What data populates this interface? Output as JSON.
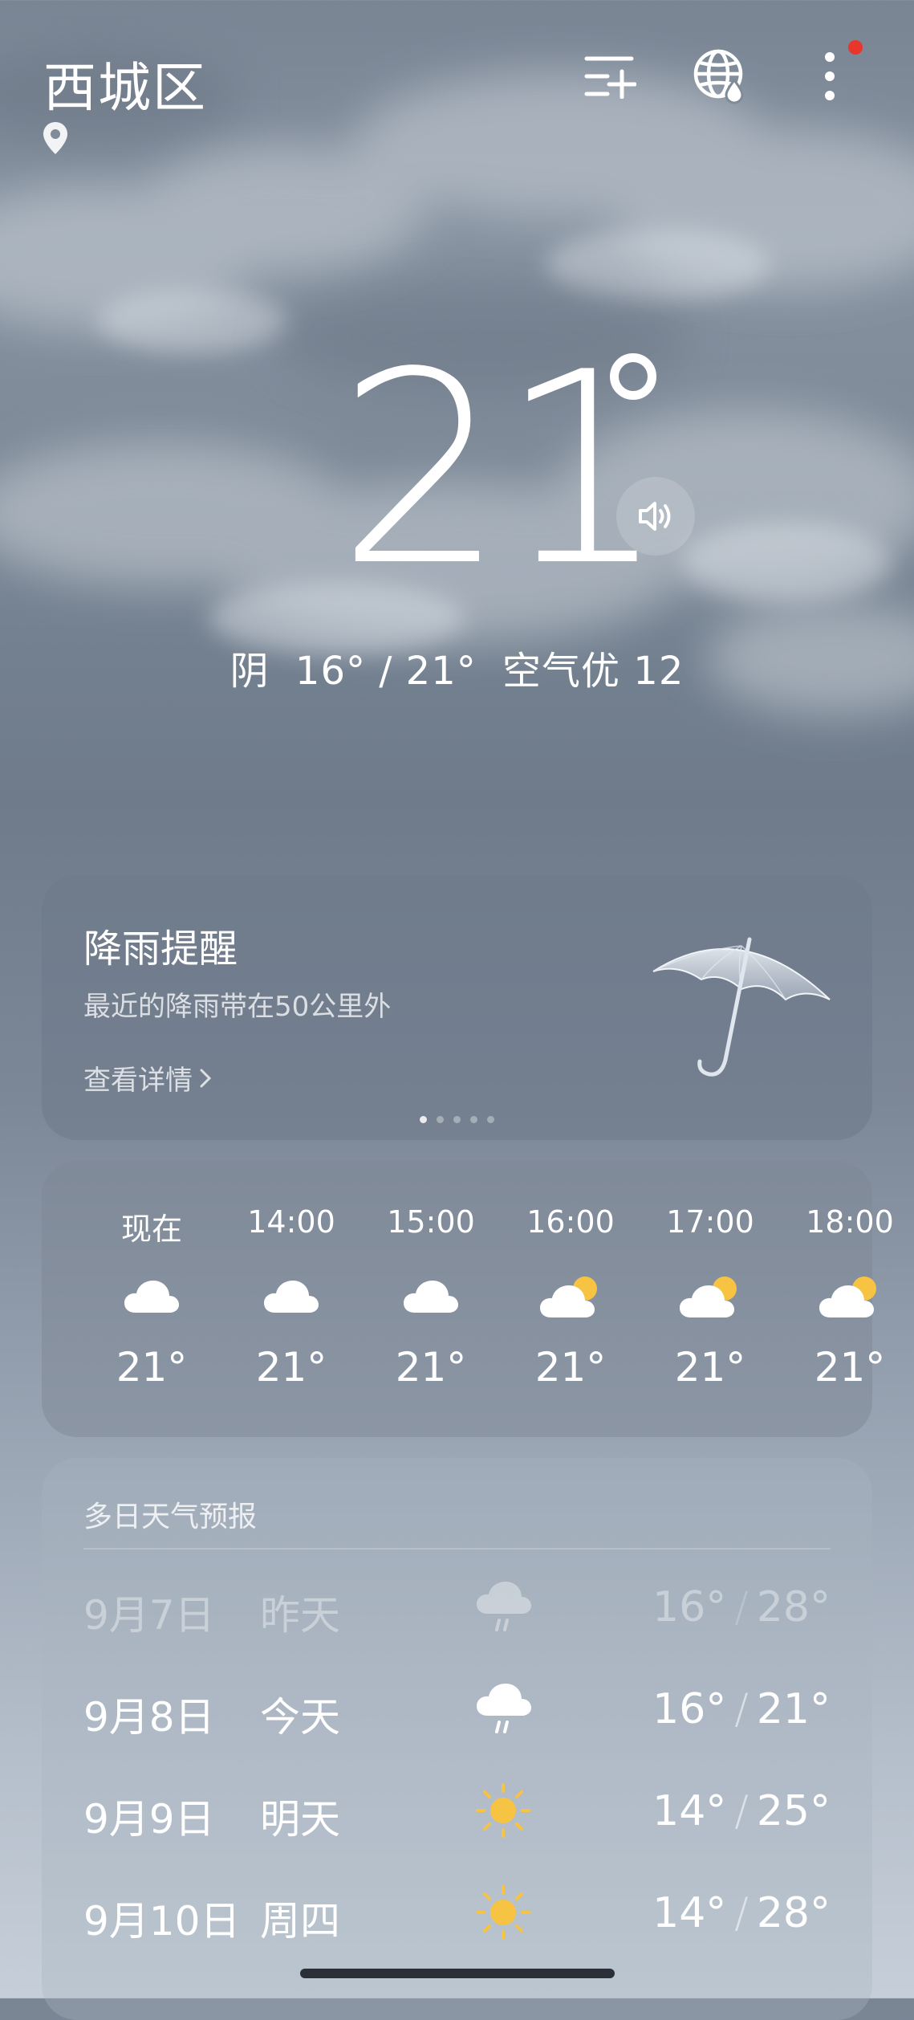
{
  "header": {
    "city": "西城区",
    "icons": [
      "location-pin-icon",
      "city-list-add-icon",
      "globe-rain-icon",
      "more-vertical-icon"
    ]
  },
  "current": {
    "temperature": "21",
    "degree_symbol": "°",
    "condition": "阴",
    "range": "16° / 21°",
    "air_quality": "空气优 12"
  },
  "rain_alert": {
    "title": "降雨提醒",
    "subtitle": "最近的降雨带在50公里外",
    "link": "查看详情",
    "page_count": 5,
    "active_page": 1
  },
  "hourly": [
    {
      "time": "现在",
      "icon": "cloud-icon",
      "temp": "21°"
    },
    {
      "time": "14:00",
      "icon": "cloud-icon",
      "temp": "21°"
    },
    {
      "time": "15:00",
      "icon": "cloud-icon",
      "temp": "21°"
    },
    {
      "time": "16:00",
      "icon": "partly-cloudy-sun-icon",
      "temp": "21°"
    },
    {
      "time": "17:00",
      "icon": "partly-cloudy-sun-icon",
      "temp": "21°"
    },
    {
      "time": "18:00",
      "icon": "partly-cloudy-sun-icon",
      "temp": "21°"
    }
  ],
  "daily": {
    "title": "多日天气预报",
    "days": [
      {
        "date": "9月7日",
        "day": "昨天",
        "icon": "light-rain-icon",
        "low": "16°",
        "high": "28°",
        "past": true
      },
      {
        "date": "9月8日",
        "day": "今天",
        "icon": "light-rain-icon",
        "low": "16°",
        "high": "21°",
        "past": false
      },
      {
        "date": "9月9日",
        "day": "明天",
        "icon": "sun-icon",
        "low": "14°",
        "high": "25°",
        "past": false
      },
      {
        "date": "9月10日",
        "day": "周四",
        "icon": "sun-icon",
        "low": "14°",
        "high": "28°",
        "past": false
      }
    ],
    "separator": "/"
  },
  "colors": {
    "sun": "#f6c343",
    "notification_dot": "#e8362d"
  }
}
